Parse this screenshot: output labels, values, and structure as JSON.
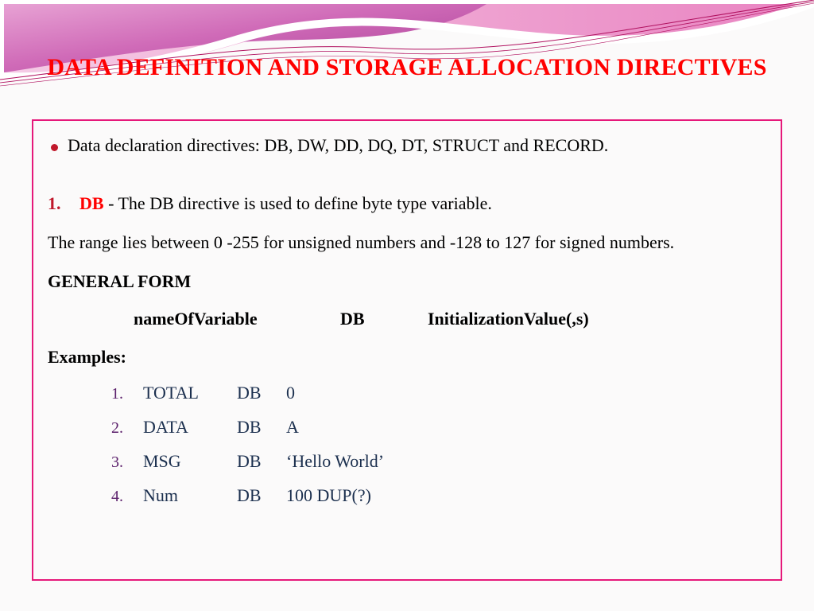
{
  "title": "DATA DEFINITION AND STORAGE ALLOCATION DIRECTIVES",
  "bullet1": "Data declaration directives: DB, DW, DD, DQ, DT, STRUCT and RECORD.",
  "item1": {
    "ordinal": "1.",
    "label": "DB",
    "desc": " - The DB directive is used to define byte type variable."
  },
  "range": "The range lies between 0 -255 for unsigned numbers and -128 to 127 for signed  numbers.",
  "gf_heading": "GENERAL FORM",
  "gf": {
    "c1": "nameOfVariable",
    "c2": "DB",
    "c3": "InitializationValue(,s)"
  },
  "ex_heading": "Examples:",
  "examples": [
    {
      "ord": "1.",
      "name": "TOTAL",
      "dir": "DB",
      "val": "0"
    },
    {
      "ord": "2.",
      "name": "DATA",
      "dir": "DB",
      "val": "A"
    },
    {
      "ord": "3.",
      "name": "MSG",
      "dir": "DB",
      "val": "‘Hello World’"
    },
    {
      "ord": "4.",
      "name": "Num",
      "dir": "DB",
      "val": "100 DUP(?)"
    }
  ]
}
